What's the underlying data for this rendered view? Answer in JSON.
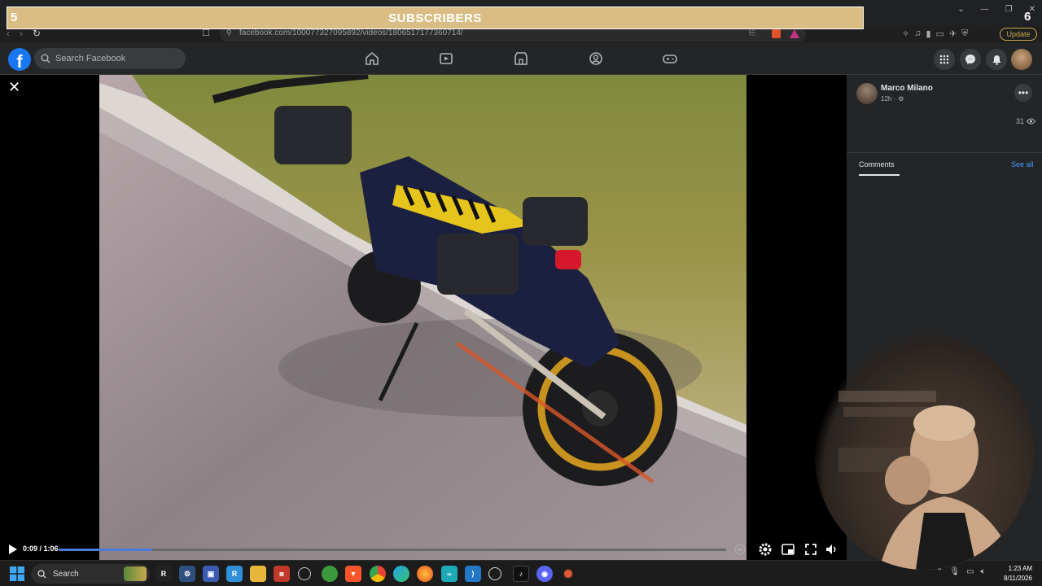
{
  "banner": {
    "left_number": "5",
    "title": "SUBSCRIBERS",
    "right_number": "6"
  },
  "browser": {
    "url": "facebook.com/100077327095892/videos/1806517177360714/",
    "update_label": "Update"
  },
  "facebook": {
    "logo": "f",
    "search_placeholder": "Search Facebook"
  },
  "video": {
    "time_label": "0:09 / 1:06",
    "progress_fraction": 0.14
  },
  "post": {
    "author": "Marco Milano",
    "time": "12h ·",
    "views": "31",
    "comments_tab": "Comments",
    "see_all": "See all"
  },
  "taskbar": {
    "search_label": "Search",
    "clock_time": "1:23 AM",
    "clock_date": "8/11/2026"
  },
  "colors": {
    "fb_blue": "#1877f2",
    "banner_bg": "#d9bd84",
    "progress_fill": "#4a7bdc"
  }
}
